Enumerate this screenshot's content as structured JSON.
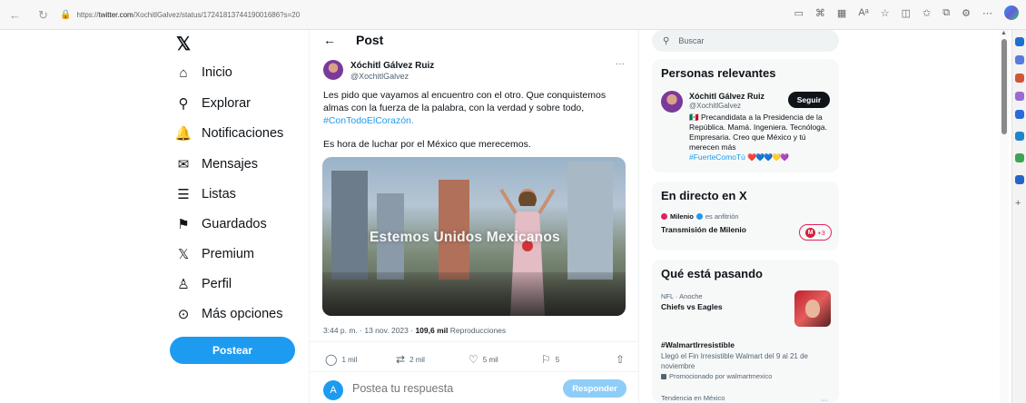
{
  "browser": {
    "url_prefix": "https://",
    "url_host": "twitter.com",
    "url_path": "/XochitlGalvez/status/1724181374419001686?s=20"
  },
  "nav": {
    "logo": "𝕏",
    "items": [
      {
        "label": "Inicio",
        "icon": "home-icon",
        "glyph": "⌂"
      },
      {
        "label": "Explorar",
        "icon": "search-icon",
        "glyph": "⚲"
      },
      {
        "label": "Notificaciones",
        "icon": "bell-icon",
        "glyph": "🔔"
      },
      {
        "label": "Mensajes",
        "icon": "mail-icon",
        "glyph": "✉"
      },
      {
        "label": "Listas",
        "icon": "list-icon",
        "glyph": "☰"
      },
      {
        "label": "Guardados",
        "icon": "bookmark-icon",
        "glyph": "⚑"
      },
      {
        "label": "Premium",
        "icon": "x-icon",
        "glyph": "𝕏"
      },
      {
        "label": "Perfil",
        "icon": "person-icon",
        "glyph": "♙"
      },
      {
        "label": "Más opciones",
        "icon": "more-icon",
        "glyph": "⊙"
      }
    ],
    "post_button": "Postear"
  },
  "post": {
    "header": "Post",
    "author_name": "Xóchitl Gálvez Ruiz",
    "author_handle": "@XochitlGalvez",
    "text_line": "Les pido que vayamos al encuentro con el otro. Que conquistemos almas con la fuerza de la palabra, con la verdad y sobre todo,",
    "hashtag": "#ConTodoElCorazón.",
    "text_line2": "Es hora de luchar por el México que merecemos.",
    "media_caption": "Estemos Unidos Mexicanos",
    "timestamp": "3:44 p. m. · 13 nov. 2023 · ",
    "views": "109,6 mil",
    "views_label": " Reproducciones",
    "replies": "1 mil",
    "reposts": "2 mil",
    "likes": "5 mil",
    "bookmarks": "5",
    "reply_avatar": "A",
    "reply_placeholder": "Postea tu respuesta",
    "reply_button": "Responder"
  },
  "sidebar": {
    "search_placeholder": "Buscar",
    "relevant": {
      "title": "Personas relevantes",
      "name": "Xóchitl Gálvez Ruiz",
      "handle": "@XochitlGalvez",
      "follow": "Seguir",
      "bio": "🇲🇽 Precandidata a la Presidencia de la República. Mamá. Ingeniera. Tecnóloga. Empresaria. Creo que México y tú merecen más",
      "bio_hashtag": "#FuerteComoTú",
      "bio_hearts": "❤️💙💙💛💜"
    },
    "live": {
      "title": "En directo en X",
      "host": "Milenio",
      "host_suffix": "es anfitrión",
      "show": "Transmisión de Milenio",
      "badge_logo": "M",
      "badge_count": "+3"
    },
    "trends": {
      "title": "Qué está pasando",
      "items": [
        {
          "context": "NFL · Anoche",
          "title": "Chiefs vs Eagles"
        },
        {
          "context": "",
          "title": "#WalmartIrresistible",
          "desc": "Llegó el Fin Irresistible Walmart del 9 al 21 de noviembre",
          "promo": "Promocionado por walmartmexico"
        },
        {
          "context": "Tendencia en México",
          "title": ""
        }
      ]
    }
  },
  "colors": {
    "accent": "#1d9bf0",
    "text": "#0f1419",
    "muted": "#536471",
    "card": "#f7f9f9"
  }
}
